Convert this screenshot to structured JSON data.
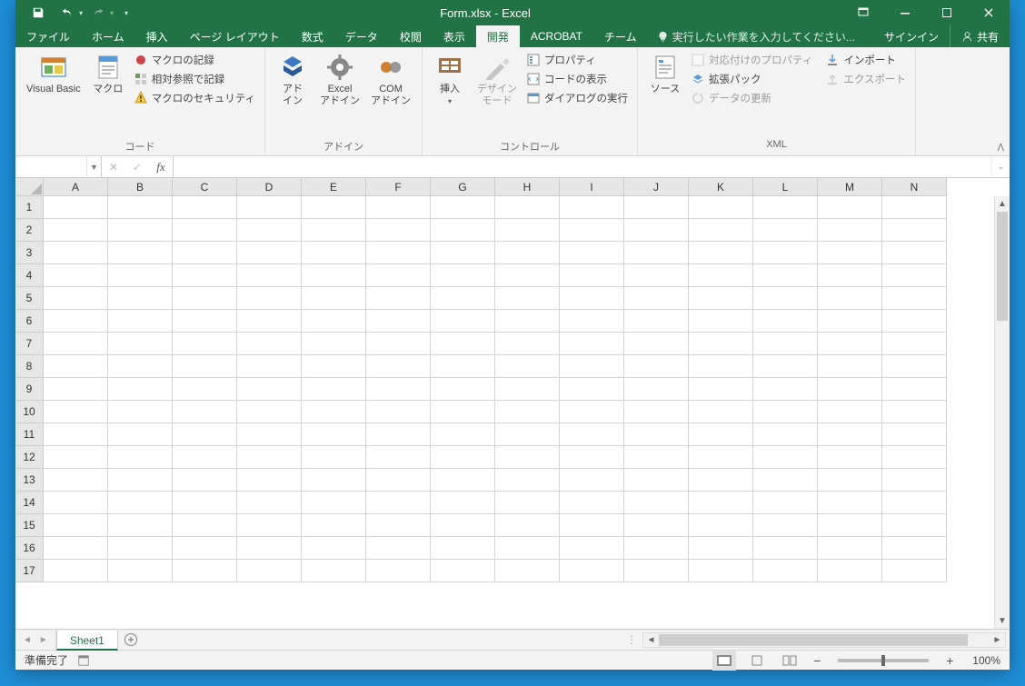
{
  "title": "Form.xlsx - Excel",
  "qat": {
    "undo_redo_disabled": true
  },
  "tabs": {
    "file": "ファイル",
    "home": "ホーム",
    "insert": "挿入",
    "page_layout": "ページ レイアウト",
    "formulas": "数式",
    "data": "データ",
    "review": "校閲",
    "view": "表示",
    "developer": "開発",
    "acrobat": "ACROBAT",
    "team": "チーム"
  },
  "active_tab": "developer",
  "tellme_placeholder": "実行したい作業を入力してください...",
  "signin": "サインイン",
  "share": "共有",
  "ribbon": {
    "code": {
      "label": "コード",
      "visual_basic": "Visual Basic",
      "macros": "マクロ",
      "record_macro": "マクロの記録",
      "relative_reference": "相対参照で記録",
      "macro_security": "マクロのセキュリティ"
    },
    "addins": {
      "label": "アドイン",
      "addins": "アド\nイン",
      "excel_addins": "Excel\nアドイン",
      "com_addins": "COM\nアドイン"
    },
    "controls": {
      "label": "コントロール",
      "insert": "挿入",
      "design_mode": "デザイン\nモード",
      "properties": "プロパティ",
      "view_code": "コードの表示",
      "run_dialog": "ダイアログの実行"
    },
    "xml": {
      "label": "XML",
      "source": "ソース",
      "map_properties": "対応付けのプロパティ",
      "expansion_pack": "拡張パック",
      "refresh_data": "データの更新",
      "import": "インポート",
      "export": "エクスポート"
    }
  },
  "namebox": "",
  "formula": "",
  "columns": [
    "A",
    "B",
    "C",
    "D",
    "E",
    "F",
    "G",
    "H",
    "I",
    "J",
    "K",
    "L",
    "M",
    "N"
  ],
  "rows": [
    1,
    2,
    3,
    4,
    5,
    6,
    7,
    8,
    9,
    10,
    11,
    12,
    13,
    14,
    15,
    16,
    17
  ],
  "sheet": {
    "active": "Sheet1"
  },
  "status": {
    "ready": "準備完了",
    "zoom": "100%"
  }
}
